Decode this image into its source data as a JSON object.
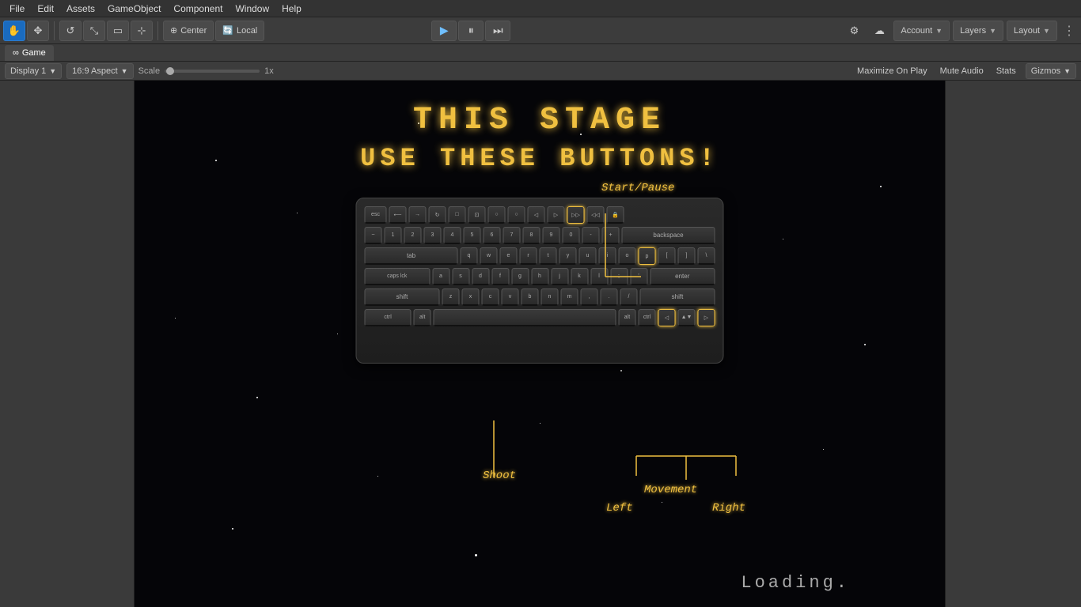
{
  "menubar": {
    "items": [
      "File",
      "Edit",
      "Assets",
      "GameObject",
      "Component",
      "Window",
      "Help"
    ]
  },
  "toolbar": {
    "tools": [
      {
        "name": "hand",
        "icon": "✋",
        "active": true
      },
      {
        "name": "move",
        "icon": "✥",
        "active": false
      },
      {
        "name": "rotate",
        "icon": "↺",
        "active": false
      },
      {
        "name": "scale",
        "icon": "⤡",
        "active": false
      },
      {
        "name": "rect",
        "icon": "▭",
        "active": false
      },
      {
        "name": "transform",
        "icon": "⊹",
        "active": false
      }
    ],
    "center_label": "Center",
    "local_label": "Local",
    "pivot_icon": "⊕",
    "play_icon": "▶",
    "pause_icon": "⏸",
    "step_icon": "⏭",
    "account_label": "Account",
    "layers_label": "Layers",
    "layout_label": "Layout",
    "more_icon": "⋮"
  },
  "tab": {
    "icon": "∞",
    "label": "Game"
  },
  "game_toolbar": {
    "display_label": "Display 1",
    "aspect_label": "16:9 Aspect",
    "scale_label": "Scale",
    "scale_value": "1x",
    "maximize_label": "Maximize On Play",
    "mute_label": "Mute Audio",
    "stats_label": "Stats",
    "gizmos_label": "Gizmos"
  },
  "game_view": {
    "title": "THIS STAGE",
    "subtitle": "USE THESE BUTTONS!",
    "annotations": {
      "start_pause": "Start/Pause",
      "shoot": "Shoot",
      "movement": "Movement",
      "left": "Left",
      "right": "Right"
    },
    "loading": "Loading."
  }
}
